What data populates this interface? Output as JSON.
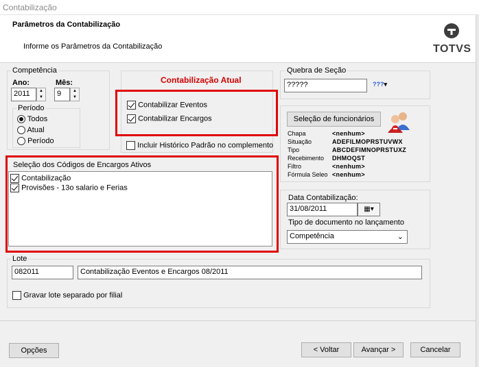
{
  "window": {
    "title": "Contabilização"
  },
  "header": {
    "title": "Parâmetros da Contabilização",
    "subtitle": "Informe os Parâmetros da Contabilização",
    "logo": "TOTVS"
  },
  "competencia": {
    "label": "Competência",
    "ano_label": "Ano:",
    "ano_value": "2011",
    "mes_label": "Mês:",
    "mes_value": "9",
    "periodo": {
      "label": "Período",
      "options": [
        "Todos",
        "Atual",
        "Período"
      ],
      "selected": "Todos"
    }
  },
  "contabilizacao_atual": {
    "label": "Contabilização Atual",
    "eventos": "Contabilizar Eventos",
    "encargos": "Contabilizar Encargos",
    "historico": "Incluir Histórico Padrão no complemento"
  },
  "quebra": {
    "label": "Quebra de Seção",
    "value": "?????",
    "dropdown_label": "???"
  },
  "selecao_func": {
    "button": "Seleção de funcionários",
    "rows": [
      {
        "label": "Chapa",
        "value": "<nenhum>"
      },
      {
        "label": "Situação",
        "value": "ADEFILMOPRSTUVWX"
      },
      {
        "label": "Tipo",
        "value": "ABCDEFIMNOPRSTUXZ"
      },
      {
        "label": "Recebimento",
        "value": "DHMOQST"
      },
      {
        "label": "Filtro",
        "value": "<nenhum>"
      },
      {
        "label": "Fórmula Seleo",
        "value": "<nenhum>"
      }
    ]
  },
  "encargos": {
    "label": "Seleção dos Códigos de Encargos Ativos",
    "items": [
      "Contabilização",
      "Provisões - 13o salario e Ferias"
    ]
  },
  "data_contab": {
    "label": "Data Contabilização:",
    "value": "31/08/2011",
    "tipo_label": "Tipo de documento no lançamento",
    "tipo_value": "Competência"
  },
  "lote": {
    "label": "Lote",
    "code": "082011",
    "description": "Contabilização Eventos e Encargos 08/2011",
    "separado": "Gravar lote separado por filial"
  },
  "footer": {
    "opcoes": "Opções",
    "voltar": "< Voltar",
    "avancar": "Avançar >",
    "cancelar": "Cancelar"
  },
  "colors": {
    "highlight": "#e00000",
    "title_red": "#d40000"
  }
}
